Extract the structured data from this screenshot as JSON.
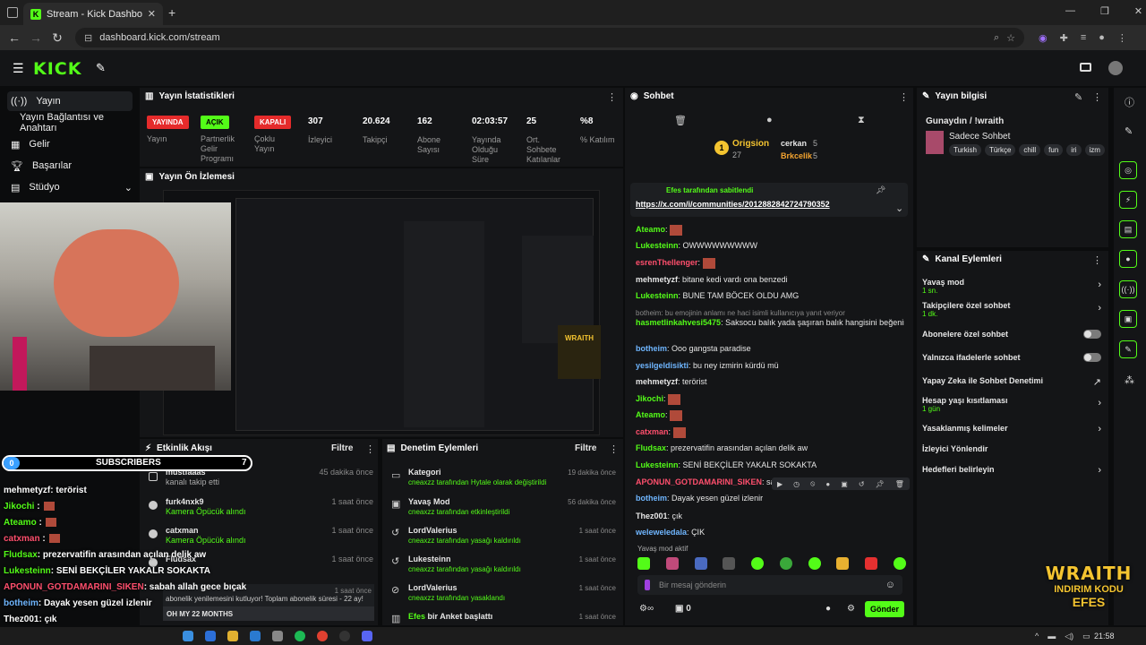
{
  "browser": {
    "tab_title": "Stream - Kick Dashboard",
    "url": "dashboard.kick.com/stream"
  },
  "header": {
    "logo": "KICK"
  },
  "sidebar": {
    "items": [
      {
        "label": "Yayın"
      },
      {
        "label": "Yayın Bağlantısı ve Anahtarı"
      },
      {
        "label": "Gelir"
      },
      {
        "label": "Başarılar"
      },
      {
        "label": "Stüdyo"
      }
    ]
  },
  "stats": {
    "title": "Yayın İstatistikleri",
    "badges": [
      {
        "text": "YAYINDA",
        "label": "Yayın",
        "color": "#e52b2b"
      },
      {
        "text": "AÇIK",
        "label": "Partnerlik Gelir Programı",
        "color": "#53fc18"
      },
      {
        "text": "KAPALI",
        "label": "Çoklu Yayın",
        "color": "#e52b2b"
      }
    ],
    "values": [
      {
        "value": "307",
        "label": "İzleyici"
      },
      {
        "value": "20.624",
        "label": "Takipçi"
      },
      {
        "value": "162",
        "label": "Abone Sayısı"
      },
      {
        "value": "02:03:57",
        "label": "Yayında Olduğu Süre"
      },
      {
        "value": "25",
        "label": "Ort. Sohbete Katılanlar"
      },
      {
        "value": "%8",
        "label": "% Katılım"
      }
    ]
  },
  "preview": {
    "title": "Yayın Ön İzlemesi"
  },
  "activity": {
    "title": "Etkinlik Akışı",
    "filter": "Filtre",
    "items": [
      {
        "name": "mustfaaas",
        "desc": "kanalı takip etti",
        "time": "45 dakika önce"
      },
      {
        "name": "furk4nxk9",
        "desc": "Kamera Öpücük alındı",
        "time": "1 saat önce"
      },
      {
        "name": "catxman",
        "desc": "Kamera Öpücük alındı",
        "time": "1 saat önce"
      },
      {
        "name": "Fludsax",
        "desc": "",
        "time": "1 saat önce"
      },
      {
        "name": "",
        "desc": "abonelik yenilemesini kutluyor! Toplam abonelik süresi - 22 ay!",
        "time": "1 saat önce"
      }
    ],
    "footer": "OH MY 22 MONTHS"
  },
  "mod": {
    "title": "Denetim Eylemleri",
    "filter": "Filtre",
    "items": [
      {
        "name": "Kategori",
        "desc": "cneaxzz tarafından Hytale olarak değiştirildi",
        "time": "19 dakika önce"
      },
      {
        "name": "Yavaş Mod",
        "desc": "cneaxzz tarafından etkinleştirildi",
        "time": "56 dakika önce"
      },
      {
        "name": "LordValerius",
        "desc": "cneaxzz tarafından yasağı kaldırıldı",
        "time": "1 saat önce"
      },
      {
        "name": "Lukesteinn",
        "desc": "cneaxzz tarafından yasağı kaldırıldı",
        "time": "1 saat önce"
      },
      {
        "name": "LordValerius",
        "desc": "cneaxzz tarafından yasaklandı",
        "time": "1 saat önce"
      },
      {
        "name": "Efes",
        "desc": "bir Anket başlattı",
        "time": "1 saat önce"
      }
    ]
  },
  "chat": {
    "title": "Sohbet",
    "top_user": "Origsion",
    "top_count": "27",
    "user2": "cerkan",
    "user2_count": "5",
    "user3": "Brkcelik",
    "user3_count": "5",
    "pinned_by": "Efes tarafından sabitlendi",
    "pinned_link": "https://x.com/i/communities/2012882842724790352",
    "messages": [
      {
        "u": "Ateamo",
        "t": "",
        "c": "#53fc18"
      },
      {
        "u": "Lukesteinn",
        "t": "OWWWWWWWWW",
        "c": "#53fc18"
      },
      {
        "u": "esrenThellenger",
        "t": "",
        "c": "#ff4f6d"
      },
      {
        "u": "mehmetyzf",
        "t": "bitane kedi vardı ona benzedi",
        "c": "#e6e6e6"
      },
      {
        "u": "Lukesteinn",
        "t": "BUNE TAM BÖCEK OLDU AMG",
        "c": "#53fc18"
      },
      {
        "u": "",
        "t": "botheim: bu emojinin anlamı ne haci isimli kullanıcıya yanıt veriyor",
        "c": "#8a8a8a"
      },
      {
        "u": "hasmetlinkahvesi5475",
        "t": "Saksocu balık yada şaşıran balık hangisini beğenirsen artık",
        "c": "#53fc18"
      },
      {
        "u": "botheim",
        "t": "Ooo gangsta paradise",
        "c": "#6fb6ff"
      },
      {
        "u": "yesilgeldisikti",
        "t": "bu ney izmirin kürdü mü",
        "c": "#6fb6ff"
      },
      {
        "u": "mehmetyzf",
        "t": "terörist",
        "c": "#e6e6e6"
      },
      {
        "u": "Jikochi",
        "t": "",
        "c": "#53fc18"
      },
      {
        "u": "Ateamo",
        "t": "",
        "c": "#53fc18"
      },
      {
        "u": "catxman",
        "t": "",
        "c": "#ff4f6d"
      },
      {
        "u": "Fludsax",
        "t": "prezervatifin arasından açılan delik aw",
        "c": "#53fc18"
      },
      {
        "u": "Lukesteinn",
        "t": "SENİ BEKÇİLER YAKALR SOKAKTA",
        "c": "#53fc18"
      },
      {
        "u": "APONUN_GOTDAMARINI_SIKEN",
        "t": "sabah",
        "c": "#ff4f6d"
      },
      {
        "u": "botheim",
        "t": "Dayak yesen güzel izlenir",
        "c": "#6fb6ff"
      },
      {
        "u": "Thez001",
        "t": "çık",
        "c": "#e6e6e6"
      },
      {
        "u": "weleweledala",
        "t": "ÇIK",
        "c": "#6fb6ff"
      }
    ],
    "slow_mode": "Yavaş mod aktif",
    "placeholder": "Bir mesaj gönderin",
    "send": "Gönder",
    "points": "0"
  },
  "streaminfo": {
    "title": "Yayın bilgisi",
    "stream_title": "Gunaydın / !wraith",
    "category": "Sadece Sohbet",
    "tags": [
      "Turkish",
      "Türkçe",
      "chill",
      "fun",
      "iri",
      "izm"
    ]
  },
  "channel": {
    "title": "Kanal Eylemleri",
    "items": [
      {
        "label": "Yavaş mod",
        "sub": "1 sn."
      },
      {
        "label": "Takipçilere özel sohbet",
        "sub": "1 dk."
      },
      {
        "label": "Abonelere özel sohbet",
        "sub": ""
      },
      {
        "label": "Yalnızca ifadelerle sohbet",
        "sub": ""
      },
      {
        "label": "Yapay Zeka ile Sohbet Denetimi",
        "sub": ""
      },
      {
        "label": "Hesap yaşı kısıtlaması",
        "sub": "1 gün"
      },
      {
        "label": "Yasaklanmış kelimeler",
        "sub": ""
      },
      {
        "label": "İzleyici Yönlendir",
        "sub": ""
      },
      {
        "label": "Hedefleri belirleyin",
        "sub": ""
      }
    ]
  },
  "overlay": {
    "sub_count_left": "0",
    "sub_label": "SUBSCRIBERS",
    "sub_count_right": "7",
    "lines": [
      {
        "u": "mehmetyzf",
        "t": ": terörist",
        "c": "#ffffff"
      },
      {
        "u": "Jikochi",
        "t": " :",
        "c": "#53fc18"
      },
      {
        "u": "Ateamo",
        "t": " :",
        "c": "#53fc18"
      },
      {
        "u": "catxman",
        "t": " :",
        "c": "#ff4f6d"
      },
      {
        "u": "Fludsax",
        "t": ": prezervatifin arasından açılan delik aw",
        "c": "#53fc18"
      },
      {
        "u": "Lukesteinn",
        "t": ": SENİ BEKÇİLER YAKALR SOKAKTA",
        "c": "#53fc18"
      },
      {
        "u": "APONUN_GOTDAMARINI_SIKEN",
        "t": ": sabah allah gece bıçak",
        "c": "#ff4f6d"
      },
      {
        "u": "botheim",
        "t": ": Dayak yesen güzel izlenir",
        "c": "#6fb6ff"
      },
      {
        "u": "Thez001",
        "t": ": çık",
        "c": "#ffffff"
      },
      {
        "u": "weleweledala",
        "t": ": ÇIK",
        "c": "#6fb6ff"
      }
    ],
    "brand1": "WRAITH",
    "brand2": "INDIRIM KODU",
    "brand3": "EFES"
  },
  "taskbar": {
    "time": "21:58"
  }
}
